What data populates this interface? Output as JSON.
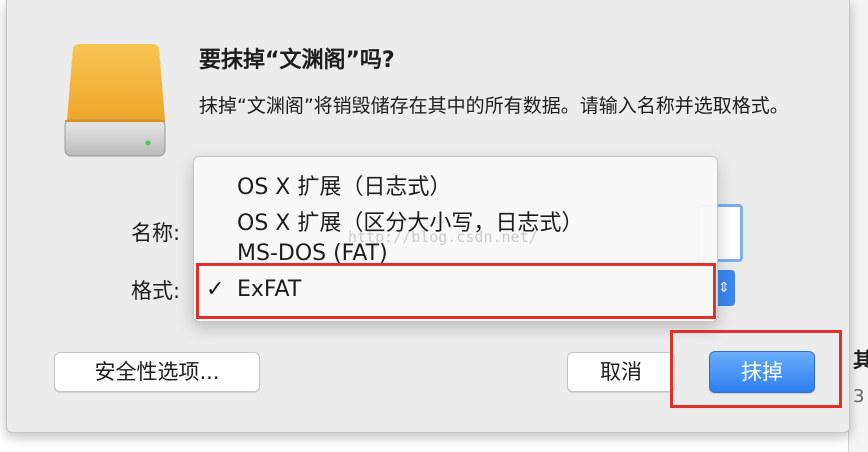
{
  "dialog": {
    "title": "要抹掉“文渊阁”吗?",
    "description": "抹掉“文渊阁”将销毁储存在其中的所有数据。请输入名称并选取格式。",
    "name_label": "名称:",
    "format_label": "格式:"
  },
  "format_menu": {
    "items": [
      {
        "label": "OS X 扩展（日志式）",
        "selected": false
      },
      {
        "label": "OS X 扩展（区分大小写，日志式）",
        "selected": false
      },
      {
        "label": "MS-DOS (FAT)",
        "selected": false
      },
      {
        "label": "ExFAT",
        "selected": true
      }
    ],
    "check_glyph": "✓"
  },
  "buttons": {
    "security": "安全性选项...",
    "cancel": "取消",
    "erase": "抹掉"
  },
  "watermark": "http://blog.csdn.net/",
  "background_window": {
    "title_fragment": "其",
    "number_fragment": "3"
  },
  "icons": {
    "drive": "external-drive-icon",
    "popup": "popup-arrows-icon"
  },
  "colors": {
    "accent": "#3b86f0",
    "annotation": "#e0302a",
    "drive_top": "#f5b43a"
  }
}
